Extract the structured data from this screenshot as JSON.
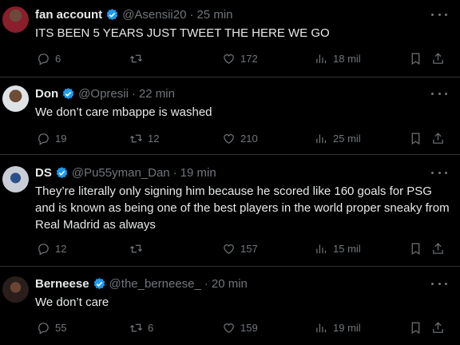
{
  "tweets": [
    {
      "name": "fan account",
      "handle": "@Asensii20",
      "dot": "·",
      "time": "25 min",
      "text": "ITS BEEN 5 YEARS JUST TWEET THE HERE WE GO",
      "replies": "6",
      "retweets": "",
      "likes": "172",
      "views": "18 mil",
      "avatar_color": "#8a1e2b"
    },
    {
      "name": "Don",
      "handle": "@Opresii",
      "dot": "·",
      "time": "22 min",
      "text": "We don’t care mbappe is washed",
      "replies": "19",
      "retweets": "12",
      "likes": "210",
      "views": "25 mil",
      "avatar_color": "#5a3b2a"
    },
    {
      "name": "DS",
      "handle": "@Pu55yman_Dan",
      "dot": "·",
      "time": "19 min",
      "text": "They’re literally only signing him because he scored like 160 goals for PSG and is known as being one of the best players in the world proper sneaky from Real Madrid as always",
      "replies": "12",
      "retweets": "",
      "likes": "157",
      "views": "15 mil",
      "avatar_color": "#c9ced6"
    },
    {
      "name": "Berneese",
      "handle": "@the_berneese_",
      "dot": "·",
      "time": "20 min",
      "text": "We don’t care",
      "replies": "55",
      "retweets": "6",
      "likes": "159",
      "views": "19 mil",
      "avatar_color": "#3a2a24"
    }
  ],
  "colors": {
    "verified": "#1d9bf0",
    "muted": "#71767b",
    "divider": "#2f3336"
  },
  "icons": [
    "reply-icon",
    "retweet-icon",
    "like-icon",
    "views-icon",
    "bookmark-icon",
    "share-icon",
    "more-icon",
    "verified-icon"
  ]
}
